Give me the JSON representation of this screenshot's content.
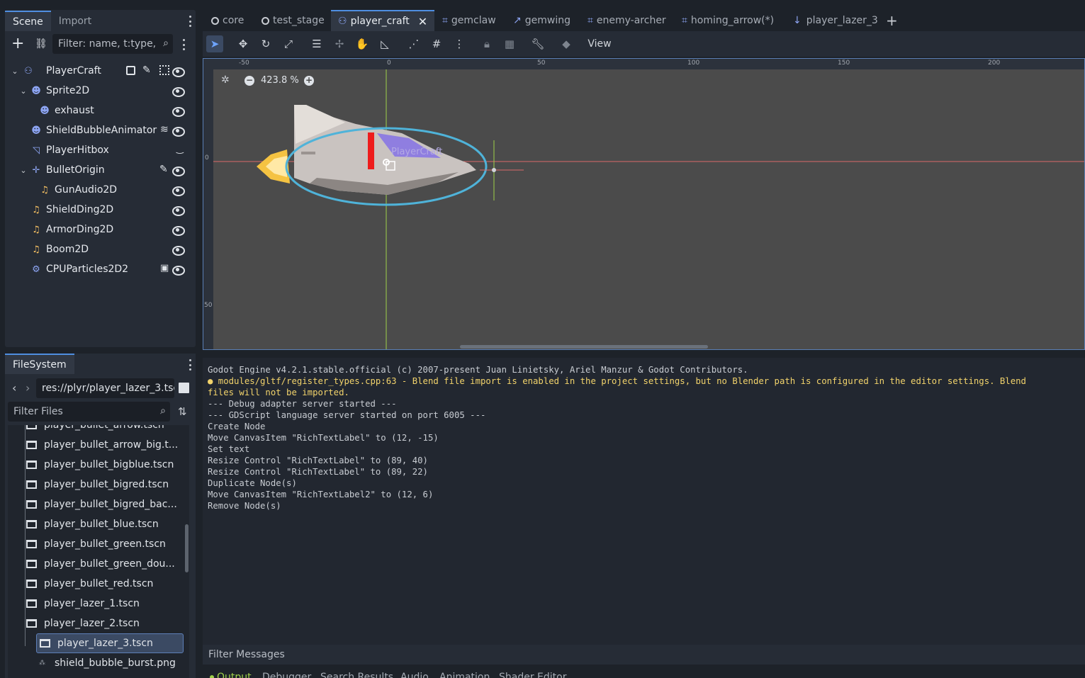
{
  "scene_dock": {
    "tabs": [
      "Scene",
      "Import"
    ],
    "filter_placeholder": "Filter: name, t:type,",
    "nodes": [
      {
        "label": "PlayerCraft",
        "icon": "node2d-icon",
        "color": "#8da5f3"
      },
      {
        "label": "Sprite2D",
        "icon": "sprite-icon",
        "color": "#8da5f3"
      },
      {
        "label": "exhaust",
        "icon": "sprite-icon",
        "color": "#8da5f3"
      },
      {
        "label": "ShieldBubbleAnimator",
        "icon": "animated-sprite-icon",
        "color": "#8da5f3"
      },
      {
        "label": "PlayerHitbox",
        "icon": "collision-icon",
        "color": "#8da5f3"
      },
      {
        "label": "BulletOrigin",
        "icon": "marker-icon",
        "color": "#8da5f3"
      },
      {
        "label": "GunAudio2D",
        "icon": "audio-icon",
        "color": "#f6c163"
      },
      {
        "label": "ShieldDing2D",
        "icon": "audio-icon",
        "color": "#f6c163"
      },
      {
        "label": "ArmorDing2D",
        "icon": "audio-icon",
        "color": "#f6c163"
      },
      {
        "label": "Boom2D",
        "icon": "audio-icon",
        "color": "#f6c163"
      },
      {
        "label": "CPUParticles2D2",
        "icon": "particles-icon",
        "color": "#8da5f3"
      }
    ]
  },
  "filesystem": {
    "title": "FileSystem",
    "path": "res://plyr/player_lazer_3.tsc",
    "filter_placeholder": "Filter Files",
    "files": [
      "player_bullet_arrow.tscn",
      "player_bullet_arrow_big.t...",
      "player_bullet_bigblue.tscn",
      "player_bullet_bigred.tscn",
      "player_bullet_bigred_bac...",
      "player_bullet_blue.tscn",
      "player_bullet_green.tscn",
      "player_bullet_green_dou...",
      "player_bullet_red.tscn",
      "player_lazer_1.tscn",
      "player_lazer_2.tscn",
      "player_lazer_3.tscn",
      "shield_bubble_burst.png"
    ],
    "selected": "player_lazer_3.tscn"
  },
  "editor_tabs": [
    "core",
    "test_stage",
    "player_craft",
    "gemclaw",
    "gemwing",
    "enemy-archer",
    "homing_arrow(*)",
    "player_lazer_3"
  ],
  "toolbar": {
    "view_label": "View"
  },
  "viewport": {
    "zoom": "423.8 %",
    "node_label": "PlayerCraft",
    "ruler_top": [
      "-50",
      "0",
      "50",
      "100",
      "150",
      "200"
    ],
    "ruler_left": [
      "0",
      "50"
    ]
  },
  "output": {
    "lines": [
      {
        "text": "Godot Engine v4.2.1.stable.official (c) 2007-present Juan Linietsky, Ariel Manzur & Godot Contributors.",
        "kind": "info"
      },
      {
        "text": "● modules/gltf/register_types.cpp:63 - Blend file import is enabled in the project settings, but no Blender path is configured in the editor settings. Blend",
        "kind": "warn"
      },
      {
        "text": "files will not be imported.",
        "kind": "warn"
      },
      {
        "text": "--- Debug adapter server started ---",
        "kind": "info"
      },
      {
        "text": "--- GDScript language server started on port 6005 ---",
        "kind": "info"
      },
      {
        "text": "Create Node",
        "kind": "info"
      },
      {
        "text": "Move CanvasItem \"RichTextLabel\" to (12, -15)",
        "kind": "info"
      },
      {
        "text": "Set text",
        "kind": "info"
      },
      {
        "text": "Resize Control \"RichTextLabel\" to (89, 40)",
        "kind": "info"
      },
      {
        "text": "Resize Control \"RichTextLabel\" to (89, 22)",
        "kind": "info"
      },
      {
        "text": "Duplicate Node(s)",
        "kind": "info"
      },
      {
        "text": "Move CanvasItem \"RichTextLabel2\" to (12, 6)",
        "kind": "info"
      },
      {
        "text": "Remove Node(s)",
        "kind": "info"
      }
    ],
    "filter_placeholder": "Filter Messages"
  },
  "bottom_tabs": [
    "Output",
    "Debugger",
    "Search Results",
    "Audio",
    "Animation",
    "Shader Editor"
  ]
}
